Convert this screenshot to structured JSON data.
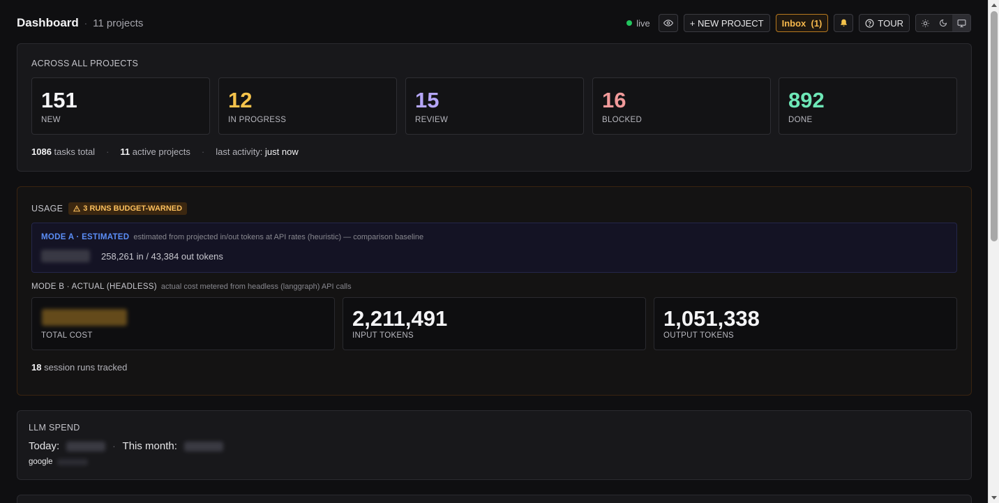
{
  "header": {
    "title": "Dashboard",
    "separator": "·",
    "project_count": "11 projects",
    "live_label": "live",
    "new_project_label": "+ NEW PROJECT",
    "inbox_label": "Inbox",
    "inbox_count": "(1)",
    "tour_label": "TOUR"
  },
  "overview": {
    "section_label": "ACROSS ALL PROJECTS",
    "stats": [
      {
        "value": "151",
        "label": "NEW",
        "color": "#f5f5f7"
      },
      {
        "value": "12",
        "label": "IN PROGRESS",
        "color": "#f5c34b"
      },
      {
        "value": "15",
        "label": "REVIEW",
        "color": "#b5a6f7"
      },
      {
        "value": "16",
        "label": "BLOCKED",
        "color": "#f19a9a"
      },
      {
        "value": "892",
        "label": "DONE",
        "color": "#6ee7b7"
      }
    ],
    "summary": {
      "tasks_total_value": "1086",
      "tasks_total_label": "tasks total",
      "active_projects_value": "11",
      "active_projects_label": "active projects",
      "last_activity_label": "last activity:",
      "last_activity_value": "just now",
      "dot": "·"
    }
  },
  "usage": {
    "section_label": "USAGE",
    "warning_badge": "3 RUNS BUDGET-WARNED",
    "mode_a": {
      "title": "MODE A · ESTIMATED",
      "description": "estimated from projected in/out tokens at API rates (heuristic) — comparison baseline",
      "tokens": "258,261 in / 43,384 out tokens"
    },
    "mode_b": {
      "title": "MODE B · ACTUAL (HEADLESS)",
      "description": "actual cost metered from headless (langgraph) API calls",
      "cards": [
        {
          "value": "",
          "label": "TOTAL COST"
        },
        {
          "value": "2,211,491",
          "label": "INPUT TOKENS"
        },
        {
          "value": "1,051,338",
          "label": "OUTPUT TOKENS"
        }
      ]
    },
    "runs_value": "18",
    "runs_label": "session runs tracked"
  },
  "llm_spend": {
    "section_label": "LLM SPEND",
    "today_label": "Today:",
    "month_label": "This month:",
    "dot": "·",
    "provider": "google"
  },
  "colors": {
    "accent_blue": "#5b8ef7",
    "warning": "#fbbf5c",
    "live": "#22c55e"
  }
}
